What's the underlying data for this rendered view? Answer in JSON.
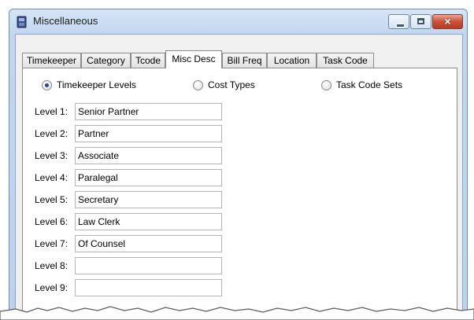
{
  "window": {
    "title": "Miscellaneous",
    "controls": {
      "minimize": "minimize",
      "maximize": "maximize",
      "close": "×"
    }
  },
  "tabs": [
    {
      "label": "Timekeeper",
      "active": false
    },
    {
      "label": "Category",
      "active": false
    },
    {
      "label": "Tcode",
      "active": false
    },
    {
      "label": "Misc Desc",
      "active": true
    },
    {
      "label": "Bill Freq",
      "active": false
    },
    {
      "label": "Location",
      "active": false
    },
    {
      "label": "Task Code",
      "active": false
    }
  ],
  "radios": [
    {
      "label": "Timekeeper Levels",
      "checked": true
    },
    {
      "label": "Cost Types",
      "checked": false
    },
    {
      "label": "Task Code Sets",
      "checked": false
    }
  ],
  "levels": [
    {
      "label": "Level 1:",
      "value": "Senior Partner"
    },
    {
      "label": "Level 2:",
      "value": "Partner"
    },
    {
      "label": "Level 3:",
      "value": "Associate"
    },
    {
      "label": "Level 4:",
      "value": "Paralegal"
    },
    {
      "label": "Level 5:",
      "value": "Secretary"
    },
    {
      "label": "Level 6:",
      "value": "Law Clerk"
    },
    {
      "label": "Level 7:",
      "value": "Of Counsel"
    },
    {
      "label": "Level 8:",
      "value": ""
    },
    {
      "label": "Level 9:",
      "value": ""
    }
  ],
  "colors": {
    "title_bar": "#c2d7ef",
    "close_button": "#c9523a",
    "radio_dot": "#1d4a8c"
  }
}
